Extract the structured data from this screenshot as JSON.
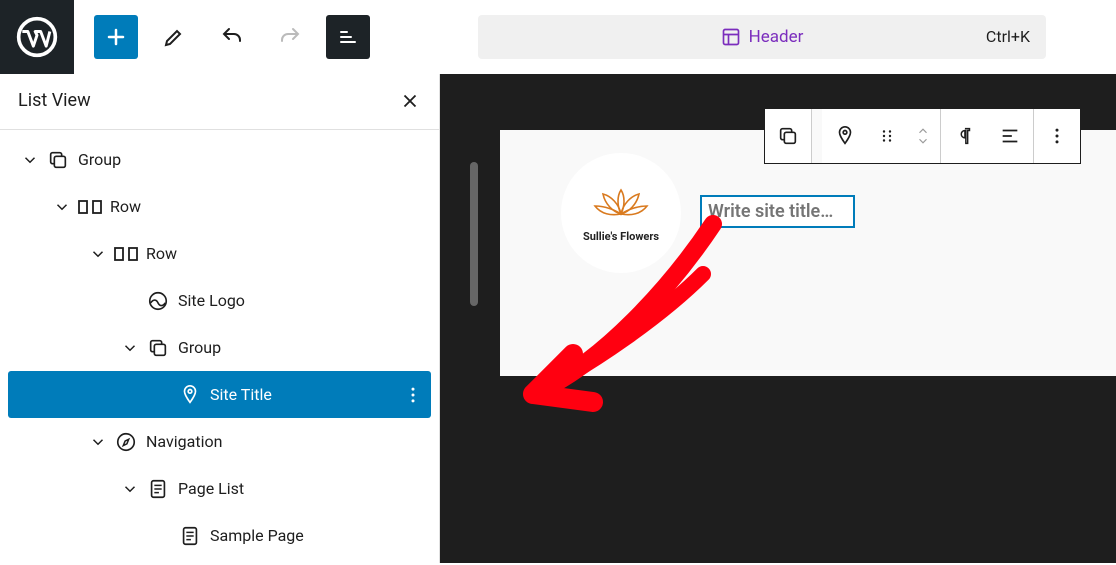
{
  "topbar": {
    "doc_label": "Header",
    "shortcut": "Ctrl+K"
  },
  "sidebar": {
    "title": "List View",
    "tree": {
      "group": "Group",
      "row1": "Row",
      "row2": "Row",
      "site_logo": "Site Logo",
      "group2": "Group",
      "site_title": "Site Title",
      "navigation": "Navigation",
      "page_list": "Page List",
      "sample_page": "Sample Page"
    }
  },
  "canvas": {
    "logo_text": "Sullie's Flowers",
    "site_title_placeholder": "Write site title…"
  }
}
